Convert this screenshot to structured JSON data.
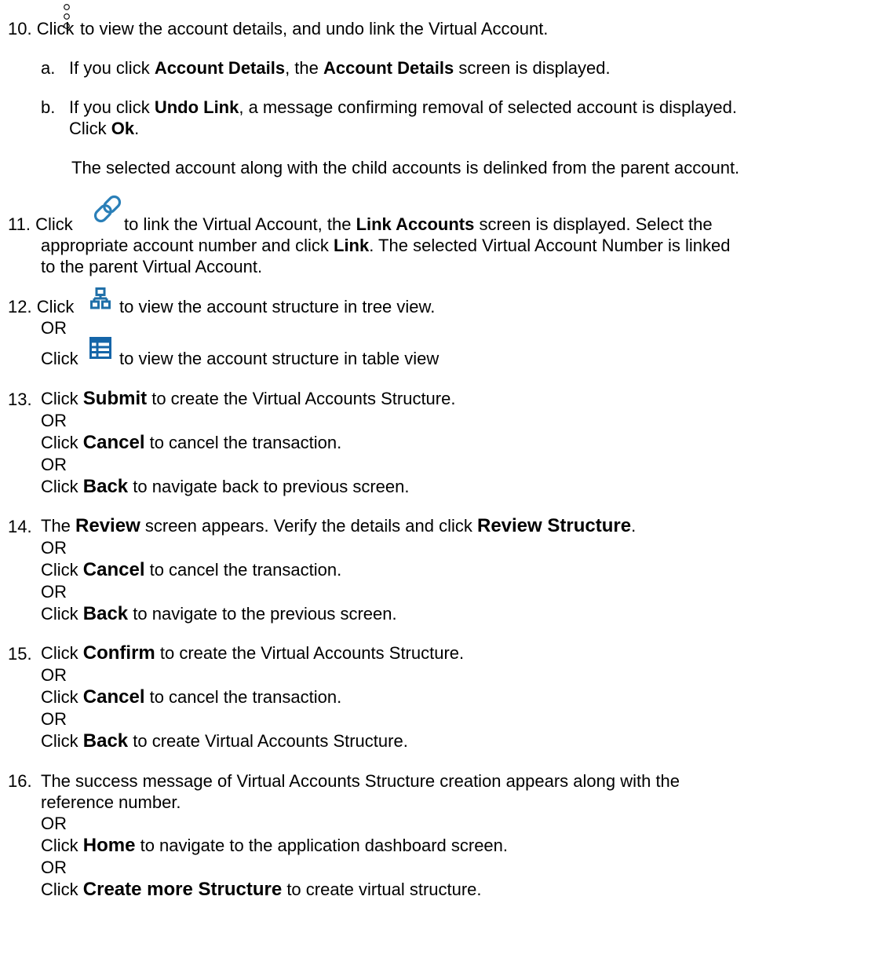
{
  "step10": {
    "number": "10.",
    "click": "Click",
    "icon": "kebab-vertical-icon",
    "rest": "to view the account details, and undo link the Virtual Account.",
    "a": {
      "marker": "a.",
      "p1": "If you click ",
      "b1": "Account Details",
      "p2": ", the ",
      "b2": "Account Details",
      "p3": " screen is displayed."
    },
    "b": {
      "marker": "b.",
      "p1": "If you click ",
      "b1": "Undo Link",
      "p2": ", a message confirming removal of selected account is displayed.",
      "p3": "Click ",
      "b2": "Ok",
      "p4": "."
    },
    "note": "The selected account along with the child accounts is delinked from the parent account."
  },
  "step11": {
    "number": "11.",
    "click": "Click",
    "icon": "link-icon",
    "p1": " to link the Virtual Account, the ",
    "b1": "Link Accounts",
    "p2": " screen is displayed. Select the",
    "line2a": "appropriate account number and click ",
    "line2b": "Link",
    "line2c": ". The selected Virtual Account Number is linked",
    "line3": "to the parent Virtual Account."
  },
  "step12": {
    "number": "12.",
    "click": "Click",
    "icon1": "tree-view-icon",
    "text1": "to view the account structure in tree view.",
    "or": "OR",
    "click2": "Click",
    "icon2": "table-view-icon",
    "text2": "to view the account structure in table view"
  },
  "step13": {
    "number": "13.",
    "l1a": "Click ",
    "l1b": "Submit",
    "l1c": " to create the Virtual Accounts Structure.",
    "or1": "OR",
    "l2a": "Click ",
    "l2b": "Cancel",
    "l2c": " to cancel the transaction.",
    "or2": "OR",
    "l3a": "Click ",
    "l3b": "Back",
    "l3c": " to navigate back to previous screen."
  },
  "step14": {
    "number": "14.",
    "l1a": "The ",
    "l1b": "Review",
    "l1c": " screen appears. Verify the details and click ",
    "l1d": "Review Structure",
    "l1e": ".",
    "or1": "OR",
    "l2a": "Click ",
    "l2b": "Cancel",
    "l2c": " to cancel the transaction.",
    "or2": "OR",
    "l3a": "Click ",
    "l3b": "Back",
    "l3c": " to navigate to the previous screen."
  },
  "step15": {
    "number": "15.",
    "l1a": "Click ",
    "l1b": "Confirm",
    "l1c": " to create the Virtual Accounts Structure.",
    "or1": "OR",
    "l2a": "Click ",
    "l2b": "Cancel",
    "l2c": " to cancel the transaction.",
    "or2": "OR",
    "l3a": "Click ",
    "l3b": "Back",
    "l3c": " to create Virtual Accounts Structure."
  },
  "step16": {
    "number": "16.",
    "line1": "The success message of Virtual Accounts Structure creation appears along with the",
    "line2": "reference number.",
    "or1": "OR",
    "l3a": "Click ",
    "l3b": "Home",
    "l3c": " to navigate to the application dashboard screen.",
    "or2": "OR",
    "l4a": "Click ",
    "l4b": "Create more Structure",
    "l4c": " to create virtual structure."
  },
  "colors": {
    "link_icon": "#2a7fb8",
    "tree_icon": "#1f6fa8",
    "table_icon": "#1565a8"
  }
}
